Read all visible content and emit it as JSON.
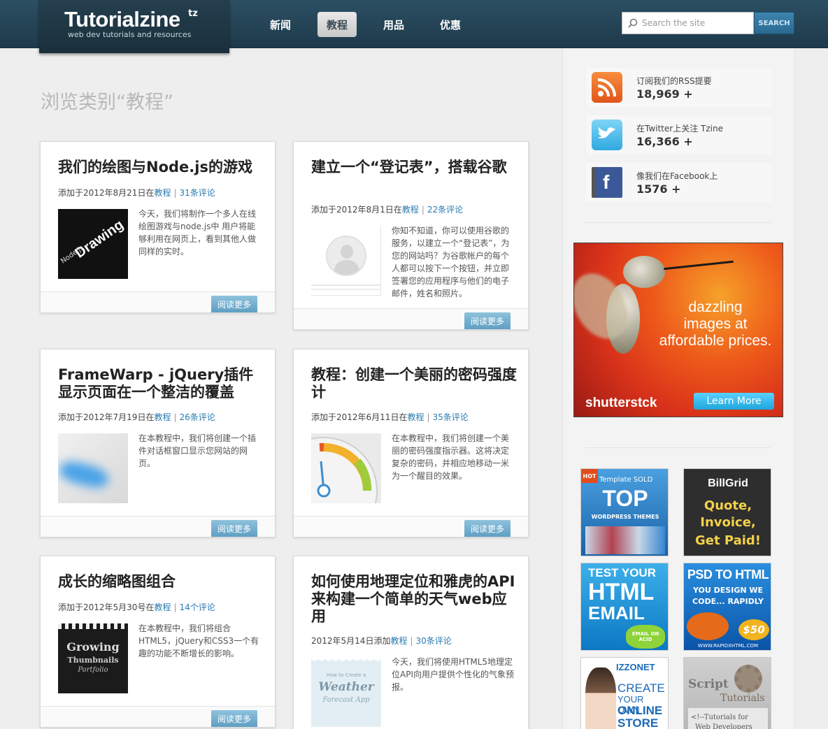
{
  "site": {
    "name": "Tutorialzine",
    "name_mark": "tz",
    "tagline": "web dev tutorials and resources"
  },
  "nav": [
    {
      "label": "新闻",
      "active": false
    },
    {
      "label": "教程",
      "active": true
    },
    {
      "label": "用品",
      "active": false
    },
    {
      "label": "优惠",
      "active": false
    }
  ],
  "search": {
    "placeholder": "Search the site",
    "button": "SEARCH"
  },
  "category_title": "浏览类别“教程”",
  "read_more": "阅读更多",
  "posts": [
    {
      "title": "我们的绘图与Node.js的游戏",
      "meta_prefix": "添加于2012年8月21日在",
      "category": "教程",
      "comments": "31条评论",
      "excerpt": "今天，我们将制作一个多人在线绘图游戏与node.js中 用户将能够利用在网页上，看到其他人做同样的实时。",
      "thumb": "node-drawing"
    },
    {
      "title": "建立一个“登记表”，搭载谷歌",
      "meta_prefix": "添加于2012年8月1日在",
      "category": "教程",
      "comments": "22条评论",
      "excerpt": "你知不知道，你可以使用谷歌的服务，以建立一个“登记表”，为您的网站吗？为谷歌帐户的每个人都可以按下一个按钮，并立即签署您的应用程序与他们的电子邮件，姓名和照片。",
      "thumb": "avatar"
    },
    {
      "title": "FrameWarp - jQuery插件显示页面在一个整洁的覆盖",
      "meta_prefix": "添加于2012年7月19日在",
      "category": "教程",
      "comments": "26条评论",
      "excerpt": "在本教程中，我们将创建一个插件对话框窗口显示您网站的网页。",
      "thumb": "framewarp"
    },
    {
      "title": "教程：创建一个美丽的密码强度计",
      "meta_prefix": "添加于2012年6月11日在",
      "category": "教程",
      "comments": "35条评论",
      "excerpt": "在本教程中，我们将创建一个美丽的密码强度指示器。这将决定复杂的密码，并相应地移动一米为一个醒目的效果。",
      "thumb": "gauge"
    },
    {
      "title": "成长的缩略图组合",
      "meta_prefix": "添加于2012年5月30号在",
      "category": "教程",
      "comments": "14个评论",
      "excerpt": "在本教程中，我们将组合HTML5，jQuery和CSS3一个有趣的功能不断增长的影响。",
      "thumb": "growing"
    },
    {
      "title": "如何使用地理定位和雅虎的API来构建一个简单的天气web应用",
      "meta_prefix": "2012年5月14日添加",
      "category": "教程",
      "comments": "30条评论",
      "excerpt": "今天，我们将使用HTML5地理定位API向用户提供个性化的气象预报。",
      "thumb": "weather"
    }
  ],
  "thumbs": {
    "node_text_top": "Drawing",
    "node_text_side": "Node.js",
    "growing_line1": "Growing",
    "growing_line2": "Thumbnails",
    "growing_line3": "Portfolio",
    "weather_small": "How to Create a",
    "weather_big": "Weather",
    "weather_sub": "Forecast App"
  },
  "social": [
    {
      "label": "订阅我们的RSS提要",
      "count": "18,969 +",
      "icon": "rss-icon"
    },
    {
      "label": "在Twitter上关注 Tzine",
      "count": "16,366 +",
      "icon": "twitter-icon"
    },
    {
      "label": "像我们在Facebook上",
      "count": "1576 +",
      "icon": "facebook-icon"
    }
  ],
  "ad_big": {
    "copy_line1": "dazzling",
    "copy_line2": "images at",
    "copy_line3": "affordable prices.",
    "brand": "shutterstck",
    "cta": "Learn More"
  },
  "ads": [
    {
      "l1": "HOT",
      "l2": "Template SOLD",
      "l3": "TOP",
      "l4": "WORDPRESS THEMES"
    },
    {
      "l1": "BillGrid",
      "l2": "Quote,",
      "l3": "Invoice,",
      "l4": "Get Paid!"
    },
    {
      "l1": "TEST YOUR",
      "l2": "HTML",
      "l3": "EMAIL",
      "l4": "EMAIL ON ACID"
    },
    {
      "l1": "PSD TO HTML",
      "l2": "YOU DESIGN WE",
      "l3": "CODE... RAPIDLY",
      "l4": "$50",
      "l5": "WWW.RAPIDXHTML.COM"
    },
    {
      "l1": "IZZONET",
      "l2": "CREATE",
      "l3": "YOUR OWN",
      "l4": "ONLINE",
      "l5": "STORE"
    },
    {
      "l1": "Script",
      "l2": "Tutorials",
      "l3": "<!--Tutorials for",
      "l4": "Web Developers"
    }
  ]
}
